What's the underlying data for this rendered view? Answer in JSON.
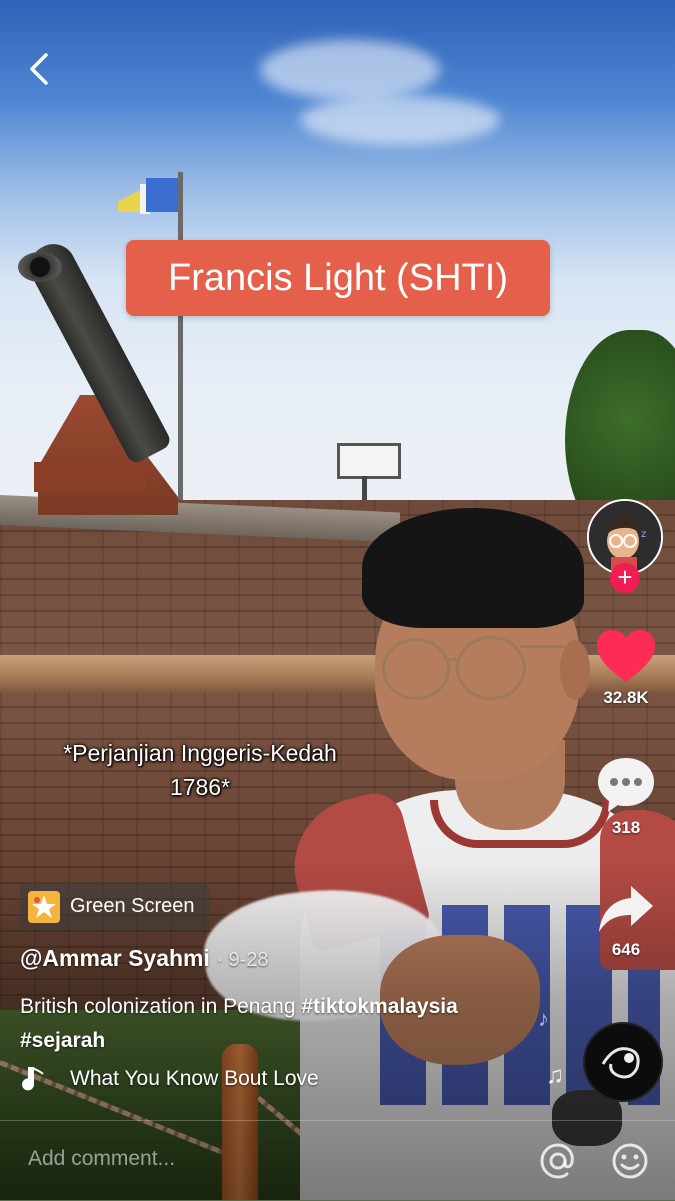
{
  "overlay": {
    "title_sticker": "Francis Light (SHTI)",
    "caption_line1": "*Perjanjian Inggeris-Kedah",
    "caption_line2": "1786*"
  },
  "actions": {
    "likes": "32.8K",
    "comments": "318",
    "shares": "646"
  },
  "effect": {
    "label": "Green Screen"
  },
  "post": {
    "author": "@Ammar Syahmi",
    "date": "· 9-28",
    "text": "British colonization in Penang ",
    "hashtag1": "#tiktokmalaysia",
    "hashtag2": "#sejarah",
    "sound": "What You Know Bout Love"
  },
  "comment_bar": {
    "placeholder": "Add comment..."
  },
  "colors": {
    "sticker_bg": "#e4604b",
    "like": "#fe2c55",
    "follow": "#ee1d52"
  },
  "icons": [
    "back-chevron-icon",
    "heart-icon",
    "comment-bubble-icon",
    "share-arrow-icon",
    "music-note-icon",
    "green-screen-effect-icon",
    "at-mention-icon",
    "emoji-icon",
    "plus-icon"
  ]
}
